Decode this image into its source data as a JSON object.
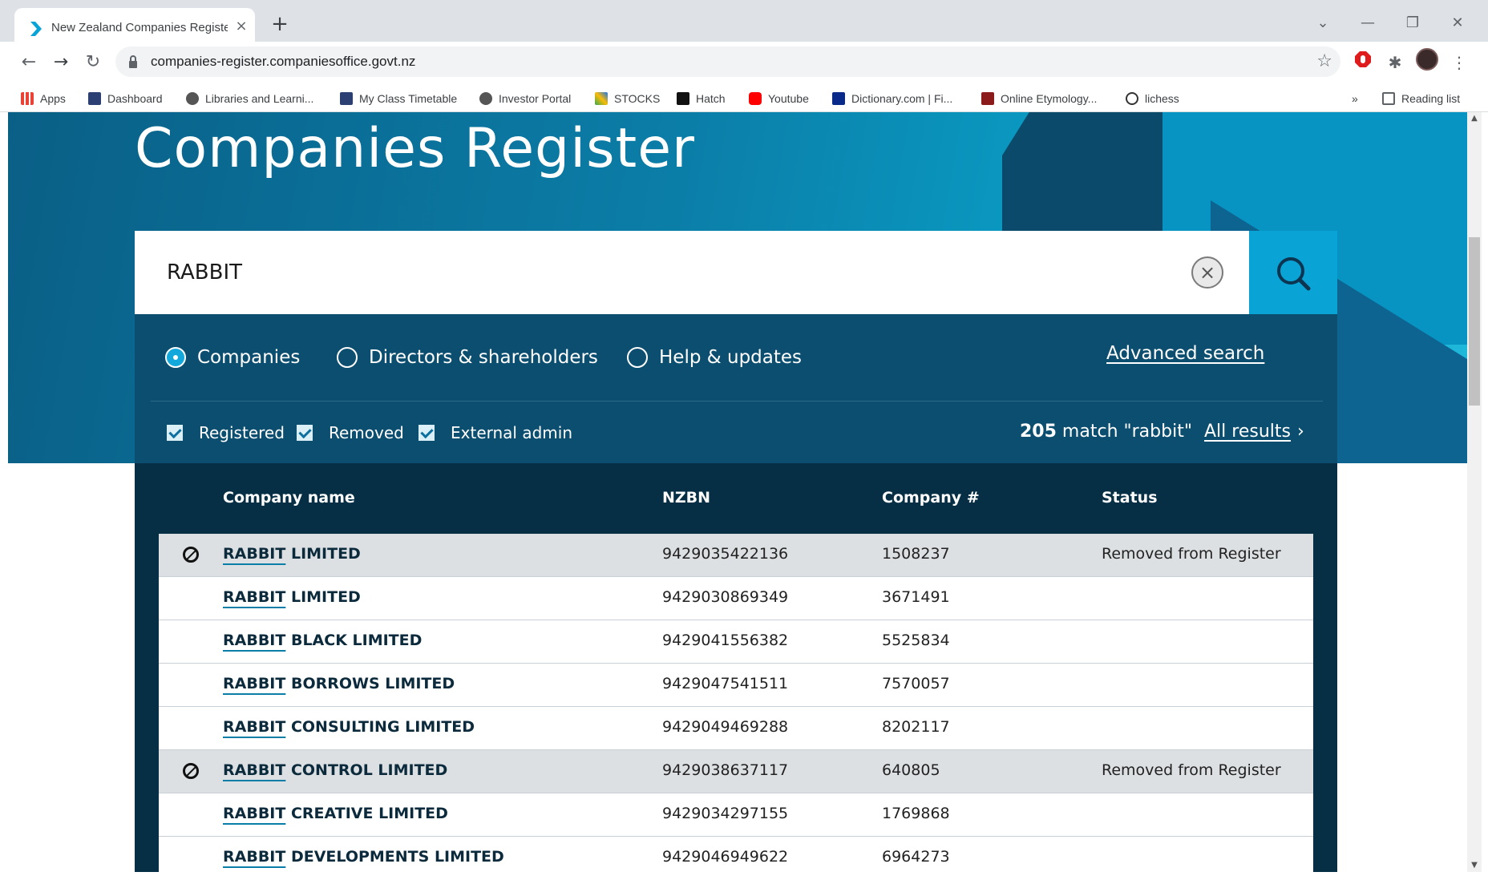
{
  "browser": {
    "tab_title": "New Zealand Companies Registe",
    "tab_close": "×",
    "new_tab": "+",
    "url": "companies-register.companiesoffice.govt.nz",
    "bookmarks": [
      {
        "label": "Apps",
        "icon": "apps-grid-icon",
        "color": "#ea4335"
      },
      {
        "label": "Dashboard",
        "icon": "shield-crest-icon",
        "color": "#2b3f73"
      },
      {
        "label": "Libraries and Learni...",
        "icon": "globe-icon",
        "color": "#555555"
      },
      {
        "label": "My Class Timetable",
        "icon": "shield-crest-icon",
        "color": "#2b3f73"
      },
      {
        "label": "Investor Portal",
        "icon": "globe-icon",
        "color": "#555555"
      },
      {
        "label": "STOCKS",
        "icon": "chart-icon",
        "color": "#1a73e8"
      },
      {
        "label": "Hatch",
        "icon": "hatch-icon",
        "color": "#111111"
      },
      {
        "label": "Youtube",
        "icon": "youtube-icon",
        "color": "#ff0000"
      },
      {
        "label": "Dictionary.com | Fi...",
        "icon": "dictionary-icon",
        "color": "#0a2a8a"
      },
      {
        "label": "Online Etymology...",
        "icon": "etymology-icon",
        "color": "#8b1a1a"
      },
      {
        "label": "lichess",
        "icon": "lichess-icon",
        "color": "#333333"
      }
    ],
    "more_bookmarks": "»",
    "reading_list": "Reading list"
  },
  "page": {
    "title": "Companies Register",
    "search_value": "RABBIT",
    "radios": {
      "companies": "Companies",
      "directors": "Directors & shareholders",
      "help": "Help & updates"
    },
    "advanced_search": "Advanced search",
    "checks": {
      "registered": "Registered",
      "removed": "Removed",
      "external_admin": "External admin"
    },
    "match_count": "205",
    "match_text": " match \"rabbit\"",
    "all_results": "All results",
    "table": {
      "headers": {
        "name": "Company name",
        "nzbn": "NZBN",
        "number": "Company #",
        "status": "Status"
      },
      "rows": [
        {
          "prefix": "RABBIT",
          "rest": " LIMITED",
          "nzbn": "9429035422136",
          "number": "1508237",
          "status": "Removed from Register",
          "removed": true
        },
        {
          "prefix": "RABBIT",
          "rest": " LIMITED",
          "nzbn": "9429030869349",
          "number": "3671491",
          "status": "",
          "removed": false
        },
        {
          "prefix": "RABBIT",
          "rest": " BLACK LIMITED",
          "nzbn": "9429041556382",
          "number": "5525834",
          "status": "",
          "removed": false
        },
        {
          "prefix": "RABBIT",
          "rest": " BORROWS LIMITED",
          "nzbn": "9429047541511",
          "number": "7570057",
          "status": "",
          "removed": false
        },
        {
          "prefix": "RABBIT",
          "rest": " CONSULTING LIMITED",
          "nzbn": "9429049469288",
          "number": "8202117",
          "status": "",
          "removed": false
        },
        {
          "prefix": "RABBIT",
          "rest": " CONTROL LIMITED",
          "nzbn": "9429038637117",
          "number": "640805",
          "status": "Removed from Register",
          "removed": true
        },
        {
          "prefix": "RABBIT",
          "rest": " CREATIVE LIMITED",
          "nzbn": "9429034297155",
          "number": "1769868",
          "status": "",
          "removed": false
        },
        {
          "prefix": "RABBIT",
          "rest": " DEVELOPMENTS LIMITED",
          "nzbn": "9429046949622",
          "number": "6964273",
          "status": "",
          "removed": false
        }
      ]
    }
  },
  "colors": {
    "brand_blue": "#0aa3d6",
    "panel_navy": "#0c4e6f",
    "table_navy": "#062f45",
    "removed_row": "#dde0e2"
  }
}
